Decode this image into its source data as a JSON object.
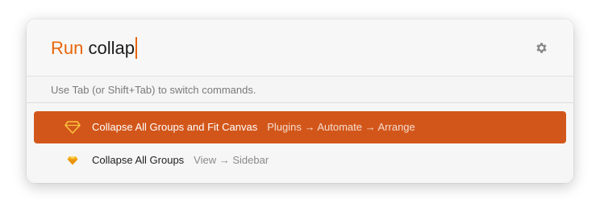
{
  "search": {
    "prefix": "Run",
    "query": "collap"
  },
  "hint": "Use Tab (or Shift+Tab) to switch commands.",
  "settings_icon": "gear-icon",
  "results": [
    {
      "title": "Collapse All Groups and Fit Canvas",
      "path": "Plugins → Automate → Arrange",
      "icon": "sketch-diamond-icon",
      "selected": true
    },
    {
      "title": "Collapse All Groups",
      "path": "View → Sidebar",
      "icon": "sketch-diamond-icon",
      "selected": false
    }
  ],
  "colors": {
    "accent": "#e8650a",
    "selection": "#d2561a",
    "gem_fill": "#f7b21b"
  }
}
